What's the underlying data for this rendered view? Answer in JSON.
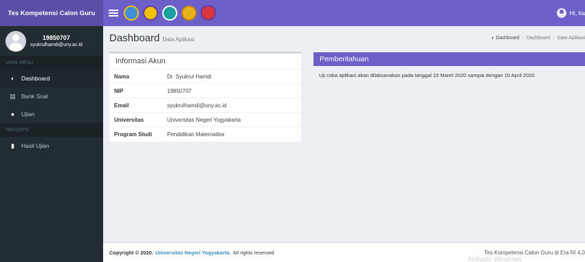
{
  "app": {
    "brand": "Tes Kompetensi Calon Guru"
  },
  "navbar": {
    "logos": [
      "logo-kemdikbud-icon",
      "logo-uny-icon",
      "logo-emblem-icon",
      "logo-gold-emblem-icon",
      "logo-red-emblem-icon"
    ],
    "greeting": "Hi, Ita"
  },
  "sidebar": {
    "user": {
      "nip": "19850707",
      "email": "syukrulhamdi@uny.ac.id"
    },
    "sections": [
      {
        "header": "MAIN MENU",
        "items": [
          {
            "label": "Dashboard",
            "icon": "dashboard-icon",
            "active": true
          },
          {
            "label": "Bank Soal",
            "icon": "file-icon",
            "active": false
          },
          {
            "label": "Ujian",
            "icon": "globe-icon",
            "active": false
          }
        ]
      },
      {
        "header": "REPORTS",
        "items": [
          {
            "label": "Hasil Ujian",
            "icon": "document-icon",
            "active": false
          }
        ]
      }
    ]
  },
  "header": {
    "title": "Dashboard",
    "subtitle": "Data Aplikasi",
    "breadcrumb": [
      "Dashboard",
      "Dashboard",
      "Data Aplikasi"
    ]
  },
  "akun": {
    "title": "Informasi Akun",
    "rows": [
      {
        "label": "Nama",
        "value": "Dr. Syukrul Hamdi"
      },
      {
        "label": "NIP",
        "value": "19850707"
      },
      {
        "label": "Email",
        "value": "syukrulhamdi@uny.ac.id"
      },
      {
        "label": "Universitas",
        "value": "Universitas Negeri Yogyakarta"
      },
      {
        "label": "Program Studi",
        "value": "Pendidikan Matematika"
      }
    ]
  },
  "pemberitahuan": {
    "title": "Pemberitahuan",
    "text": "Uji coba aplikasi akan dilaksanakan pada tanggal 15 Maret 2020 sampai dengan 10 April 2020"
  },
  "footer": {
    "copyright": "Copyright © 2020.",
    "university": "Universitas Negeri Yogyakarta.",
    "rights": "All rights reserved",
    "tagline": "Tes Kompetensi Calon Guru di Era RI 4.0"
  },
  "watermark": "Activate Windows",
  "colors": {
    "navbar": "#6c5fc7",
    "brand": "#5a4fa6",
    "sidebar": "#222d32",
    "link": "#3c8dbc"
  }
}
